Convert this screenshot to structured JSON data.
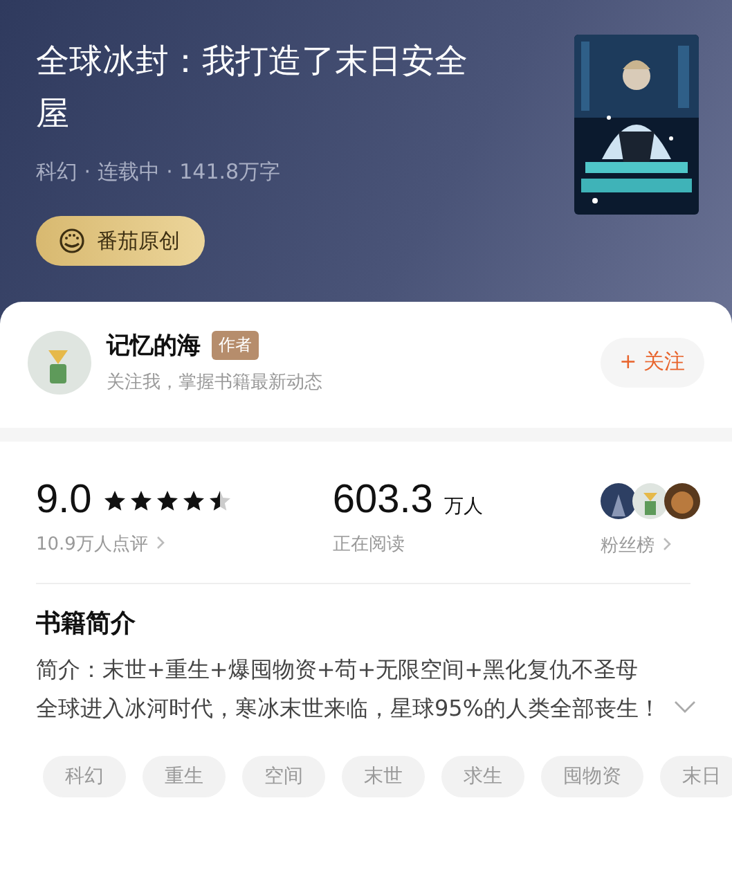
{
  "book": {
    "title": "全球冰封：我打造了末日安全屋",
    "meta": "科幻 · 连载中 · 141.8万字",
    "badge": "番茄原创"
  },
  "author": {
    "name": "记忆的海",
    "tag": "作者",
    "subtitle": "关注我，掌握书籍最新动态",
    "follow_button": "+ 关注",
    "followed": false
  },
  "stats": {
    "score": "9.0",
    "stars": 4.5,
    "reviews": "10.9万人点评",
    "readers": "603.3",
    "readers_unit": "万人",
    "readers_label": "正在阅读",
    "fans_label": "粉丝榜"
  },
  "intro": {
    "heading": "书籍简介",
    "paragraphs": [
      "简介：末世+重生+爆囤物资+苟+无限空间+黑化复仇不圣母",
      "全球进入冰河时代，寒冰末世来临，星球95%的人类全部丧生！"
    ],
    "expanded": false
  },
  "tags": [
    "科幻",
    "重生",
    "空间",
    "末世",
    "求生",
    "囤物资",
    "末日"
  ]
}
